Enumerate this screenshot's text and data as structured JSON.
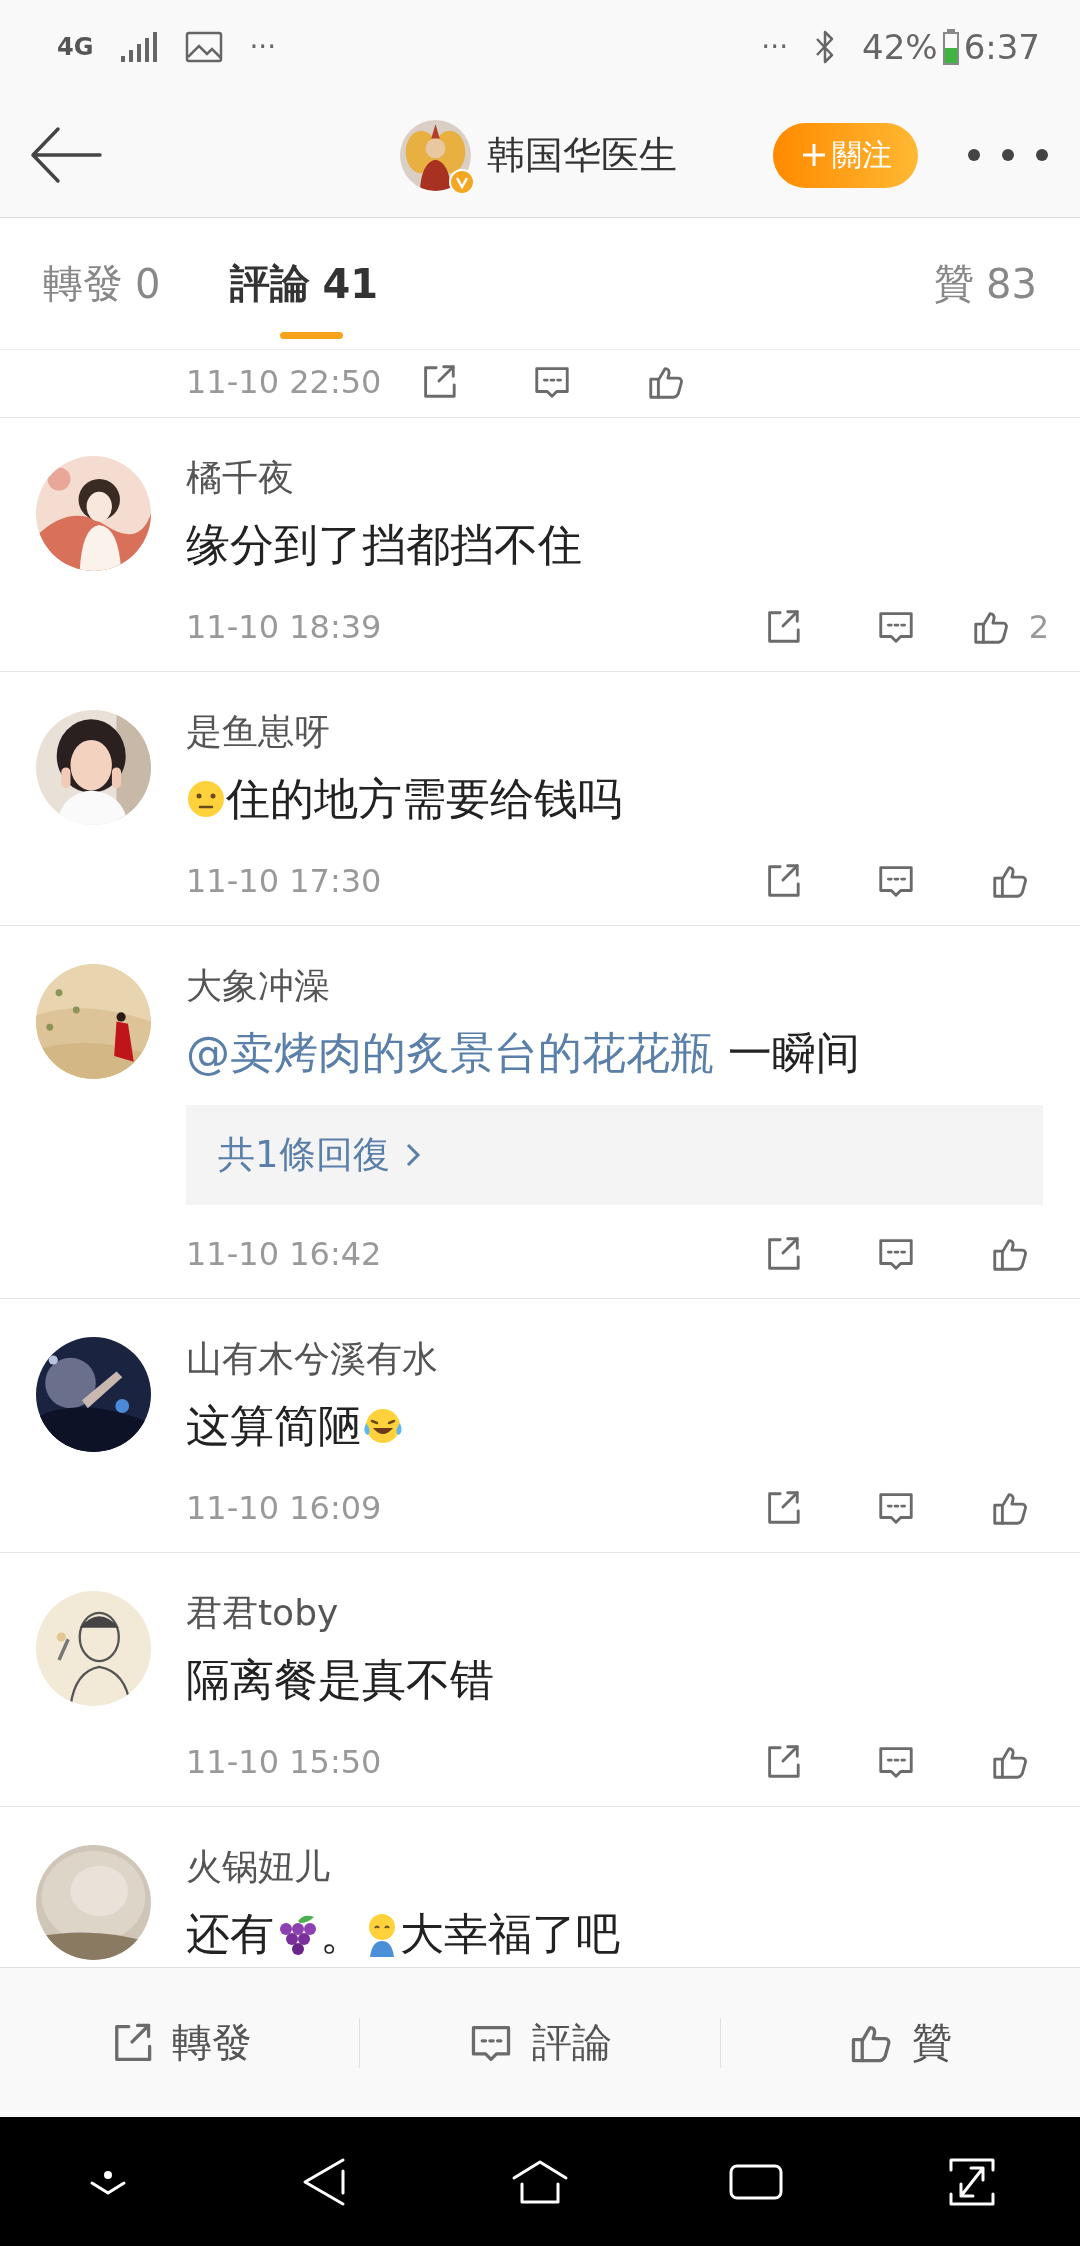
{
  "status_bar": {
    "network": "4G",
    "left_more": "···",
    "right_more": "···",
    "battery": "42%",
    "time": "6:37"
  },
  "header": {
    "title": "韩国华医生",
    "verified": true,
    "follow_button": "關注"
  },
  "tabs": [
    {
      "label": "轉發",
      "count": "0",
      "selected": false
    },
    {
      "label": "評論",
      "count": "41",
      "selected": true
    },
    {
      "label": "贊",
      "count": "83",
      "selected": false
    }
  ],
  "comments": [
    {
      "kind": "cut",
      "time": "11-10 22:50"
    },
    {
      "kind": "comment",
      "name": "橘千夜",
      "content": [
        {
          "kind": "text",
          "text": "缘分到了挡都挡不住"
        }
      ],
      "time": "11-10 18:39",
      "likes": "2"
    },
    {
      "kind": "comment",
      "name": "是鱼崽呀",
      "content": [
        {
          "kind": "smiley"
        },
        {
          "kind": "text",
          "text": "住的地方需要给钱吗"
        }
      ],
      "time": "11-10 17:30"
    },
    {
      "kind": "comment",
      "name": "大象冲澡",
      "content": [
        {
          "kind": "mention",
          "text": "@卖烤肉的炙景台的花花瓶"
        },
        {
          "kind": "text",
          "text": "一瞬间"
        }
      ],
      "replies": "共1條回復",
      "time": "11-10 16:42"
    },
    {
      "kind": "comment",
      "name": "山有木兮溪有水",
      "content": [
        {
          "kind": "text",
          "text": "这算简陋"
        },
        {
          "kind": "laugh"
        }
      ],
      "time": "11-10 16:09"
    },
    {
      "kind": "comment",
      "name": "君君toby",
      "content": [
        {
          "kind": "text",
          "text": "隔离餐是真不错"
        }
      ],
      "time": "11-10 15:50"
    },
    {
      "kind": "comment",
      "name": "火锅妞儿",
      "content": [
        {
          "kind": "text",
          "text": "还有"
        },
        {
          "kind": "grapes"
        },
        {
          "kind": "text",
          "text": "。"
        },
        {
          "kind": "figure"
        },
        {
          "kind": "text",
          "text": "大幸福了吧"
        }
      ]
    }
  ],
  "action_bar": [
    {
      "kind": "share",
      "label": "轉發"
    },
    {
      "kind": "comment",
      "label": "評論"
    },
    {
      "kind": "like",
      "label": "贊"
    }
  ]
}
